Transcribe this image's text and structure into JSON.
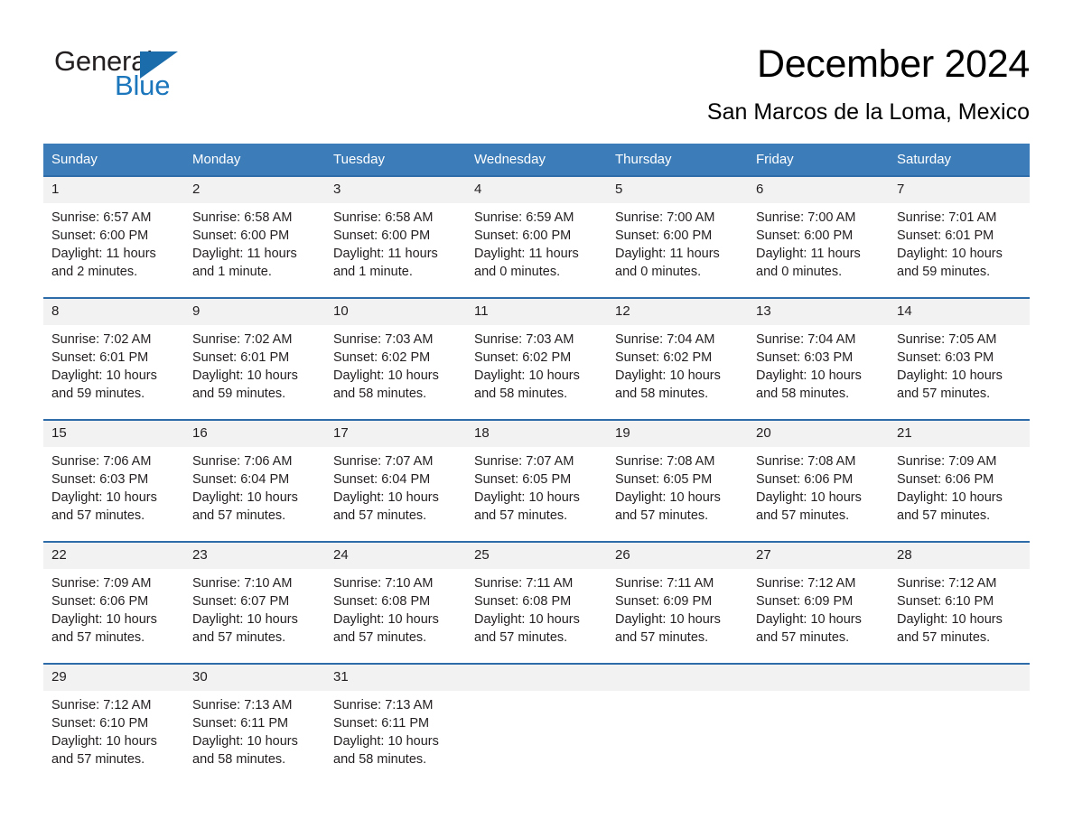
{
  "brand": {
    "name_part1": "General",
    "name_part2": "Blue",
    "accent_color": "#1b76bc",
    "triangle_color": "#1b6cab",
    "triangle_icon": "triangle-icon"
  },
  "header": {
    "title": "December 2024",
    "location": "San Marcos de la Loma, Mexico"
  },
  "calendar": {
    "header_bg": "#3c7cb8",
    "row_border_color": "#2d6ca8",
    "daynum_bg": "#f2f2f2",
    "day_names": [
      "Sunday",
      "Monday",
      "Tuesday",
      "Wednesday",
      "Thursday",
      "Friday",
      "Saturday"
    ],
    "weeks": [
      [
        {
          "day": "1",
          "sunrise": "Sunrise: 6:57 AM",
          "sunset": "Sunset: 6:00 PM",
          "daylight_line1": "Daylight: 11 hours",
          "daylight_line2": "and 2 minutes."
        },
        {
          "day": "2",
          "sunrise": "Sunrise: 6:58 AM",
          "sunset": "Sunset: 6:00 PM",
          "daylight_line1": "Daylight: 11 hours",
          "daylight_line2": "and 1 minute."
        },
        {
          "day": "3",
          "sunrise": "Sunrise: 6:58 AM",
          "sunset": "Sunset: 6:00 PM",
          "daylight_line1": "Daylight: 11 hours",
          "daylight_line2": "and 1 minute."
        },
        {
          "day": "4",
          "sunrise": "Sunrise: 6:59 AM",
          "sunset": "Sunset: 6:00 PM",
          "daylight_line1": "Daylight: 11 hours",
          "daylight_line2": "and 0 minutes."
        },
        {
          "day": "5",
          "sunrise": "Sunrise: 7:00 AM",
          "sunset": "Sunset: 6:00 PM",
          "daylight_line1": "Daylight: 11 hours",
          "daylight_line2": "and 0 minutes."
        },
        {
          "day": "6",
          "sunrise": "Sunrise: 7:00 AM",
          "sunset": "Sunset: 6:00 PM",
          "daylight_line1": "Daylight: 11 hours",
          "daylight_line2": "and 0 minutes."
        },
        {
          "day": "7",
          "sunrise": "Sunrise: 7:01 AM",
          "sunset": "Sunset: 6:01 PM",
          "daylight_line1": "Daylight: 10 hours",
          "daylight_line2": "and 59 minutes."
        }
      ],
      [
        {
          "day": "8",
          "sunrise": "Sunrise: 7:02 AM",
          "sunset": "Sunset: 6:01 PM",
          "daylight_line1": "Daylight: 10 hours",
          "daylight_line2": "and 59 minutes."
        },
        {
          "day": "9",
          "sunrise": "Sunrise: 7:02 AM",
          "sunset": "Sunset: 6:01 PM",
          "daylight_line1": "Daylight: 10 hours",
          "daylight_line2": "and 59 minutes."
        },
        {
          "day": "10",
          "sunrise": "Sunrise: 7:03 AM",
          "sunset": "Sunset: 6:02 PM",
          "daylight_line1": "Daylight: 10 hours",
          "daylight_line2": "and 58 minutes."
        },
        {
          "day": "11",
          "sunrise": "Sunrise: 7:03 AM",
          "sunset": "Sunset: 6:02 PM",
          "daylight_line1": "Daylight: 10 hours",
          "daylight_line2": "and 58 minutes."
        },
        {
          "day": "12",
          "sunrise": "Sunrise: 7:04 AM",
          "sunset": "Sunset: 6:02 PM",
          "daylight_line1": "Daylight: 10 hours",
          "daylight_line2": "and 58 minutes."
        },
        {
          "day": "13",
          "sunrise": "Sunrise: 7:04 AM",
          "sunset": "Sunset: 6:03 PM",
          "daylight_line1": "Daylight: 10 hours",
          "daylight_line2": "and 58 minutes."
        },
        {
          "day": "14",
          "sunrise": "Sunrise: 7:05 AM",
          "sunset": "Sunset: 6:03 PM",
          "daylight_line1": "Daylight: 10 hours",
          "daylight_line2": "and 57 minutes."
        }
      ],
      [
        {
          "day": "15",
          "sunrise": "Sunrise: 7:06 AM",
          "sunset": "Sunset: 6:03 PM",
          "daylight_line1": "Daylight: 10 hours",
          "daylight_line2": "and 57 minutes."
        },
        {
          "day": "16",
          "sunrise": "Sunrise: 7:06 AM",
          "sunset": "Sunset: 6:04 PM",
          "daylight_line1": "Daylight: 10 hours",
          "daylight_line2": "and 57 minutes."
        },
        {
          "day": "17",
          "sunrise": "Sunrise: 7:07 AM",
          "sunset": "Sunset: 6:04 PM",
          "daylight_line1": "Daylight: 10 hours",
          "daylight_line2": "and 57 minutes."
        },
        {
          "day": "18",
          "sunrise": "Sunrise: 7:07 AM",
          "sunset": "Sunset: 6:05 PM",
          "daylight_line1": "Daylight: 10 hours",
          "daylight_line2": "and 57 minutes."
        },
        {
          "day": "19",
          "sunrise": "Sunrise: 7:08 AM",
          "sunset": "Sunset: 6:05 PM",
          "daylight_line1": "Daylight: 10 hours",
          "daylight_line2": "and 57 minutes."
        },
        {
          "day": "20",
          "sunrise": "Sunrise: 7:08 AM",
          "sunset": "Sunset: 6:06 PM",
          "daylight_line1": "Daylight: 10 hours",
          "daylight_line2": "and 57 minutes."
        },
        {
          "day": "21",
          "sunrise": "Sunrise: 7:09 AM",
          "sunset": "Sunset: 6:06 PM",
          "daylight_line1": "Daylight: 10 hours",
          "daylight_line2": "and 57 minutes."
        }
      ],
      [
        {
          "day": "22",
          "sunrise": "Sunrise: 7:09 AM",
          "sunset": "Sunset: 6:06 PM",
          "daylight_line1": "Daylight: 10 hours",
          "daylight_line2": "and 57 minutes."
        },
        {
          "day": "23",
          "sunrise": "Sunrise: 7:10 AM",
          "sunset": "Sunset: 6:07 PM",
          "daylight_line1": "Daylight: 10 hours",
          "daylight_line2": "and 57 minutes."
        },
        {
          "day": "24",
          "sunrise": "Sunrise: 7:10 AM",
          "sunset": "Sunset: 6:08 PM",
          "daylight_line1": "Daylight: 10 hours",
          "daylight_line2": "and 57 minutes."
        },
        {
          "day": "25",
          "sunrise": "Sunrise: 7:11 AM",
          "sunset": "Sunset: 6:08 PM",
          "daylight_line1": "Daylight: 10 hours",
          "daylight_line2": "and 57 minutes."
        },
        {
          "day": "26",
          "sunrise": "Sunrise: 7:11 AM",
          "sunset": "Sunset: 6:09 PM",
          "daylight_line1": "Daylight: 10 hours",
          "daylight_line2": "and 57 minutes."
        },
        {
          "day": "27",
          "sunrise": "Sunrise: 7:12 AM",
          "sunset": "Sunset: 6:09 PM",
          "daylight_line1": "Daylight: 10 hours",
          "daylight_line2": "and 57 minutes."
        },
        {
          "day": "28",
          "sunrise": "Sunrise: 7:12 AM",
          "sunset": "Sunset: 6:10 PM",
          "daylight_line1": "Daylight: 10 hours",
          "daylight_line2": "and 57 minutes."
        }
      ],
      [
        {
          "day": "29",
          "sunrise": "Sunrise: 7:12 AM",
          "sunset": "Sunset: 6:10 PM",
          "daylight_line1": "Daylight: 10 hours",
          "daylight_line2": "and 57 minutes."
        },
        {
          "day": "30",
          "sunrise": "Sunrise: 7:13 AM",
          "sunset": "Sunset: 6:11 PM",
          "daylight_line1": "Daylight: 10 hours",
          "daylight_line2": "and 58 minutes."
        },
        {
          "day": "31",
          "sunrise": "Sunrise: 7:13 AM",
          "sunset": "Sunset: 6:11 PM",
          "daylight_line1": "Daylight: 10 hours",
          "daylight_line2": "and 58 minutes."
        },
        {
          "day": "",
          "sunrise": "",
          "sunset": "",
          "daylight_line1": "",
          "daylight_line2": ""
        },
        {
          "day": "",
          "sunrise": "",
          "sunset": "",
          "daylight_line1": "",
          "daylight_line2": ""
        },
        {
          "day": "",
          "sunrise": "",
          "sunset": "",
          "daylight_line1": "",
          "daylight_line2": ""
        },
        {
          "day": "",
          "sunrise": "",
          "sunset": "",
          "daylight_line1": "",
          "daylight_line2": ""
        }
      ]
    ]
  }
}
